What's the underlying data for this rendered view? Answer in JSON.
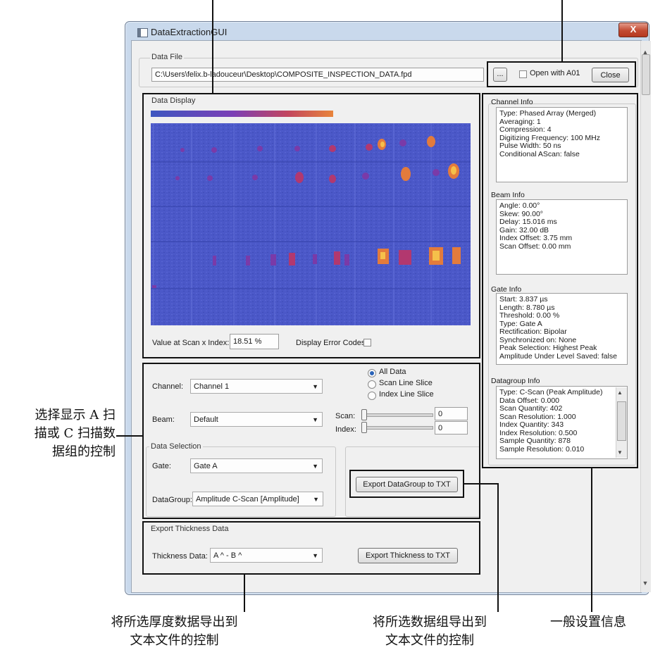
{
  "window": {
    "title": "DataExtractionGUI",
    "close_glyph": "X"
  },
  "data_file": {
    "group_label": "Data File",
    "path": "C:\\Users\\felix.b-ladouceur\\Desktop\\COMPOSITE_INSPECTION_DATA.fpd",
    "browse_label": "...",
    "open_with_label": "Open with A01",
    "close_label": "Close"
  },
  "data_display": {
    "group_label": "Data Display",
    "value_label": "Value at Scan x Index:",
    "value": "18.51 %",
    "error_codes_label": "Display Error Codes"
  },
  "controls": {
    "channel_label": "Channel:",
    "channel_value": "Channel 1",
    "beam_label": "Beam:",
    "beam_value": "Default",
    "radio_all": "All Data",
    "radio_scan": "Scan Line Slice",
    "radio_index": "Index Line Slice",
    "scan_label": "Scan:",
    "scan_value": "0",
    "index_label": "Index:",
    "index_value": "0",
    "data_selection_label": "Data Selection",
    "gate_label": "Gate:",
    "gate_value": "Gate A",
    "datagroup_label": "DataGroup:",
    "datagroup_value": "Amplitude C-Scan [Amplitude]",
    "export_datagroup_label": "Export DataGroup to TXT"
  },
  "thickness": {
    "group_label": "Export Thickness Data",
    "label": "Thickness Data:",
    "value": "A ^ - B ^",
    "export_label": "Export Thickness to TXT"
  },
  "info": {
    "channel": {
      "label": "Channel Info",
      "lines": [
        "Type: Phased Array (Merged)",
        "Averaging: 1",
        "Compression: 4",
        "Digitizing Frequency: 100 MHz",
        "Pulse Width: 50 ns",
        "Conditional AScan: false"
      ]
    },
    "beam": {
      "label": "Beam Info",
      "lines": [
        "Angle: 0.00°",
        "Skew: 90.00°",
        "Delay: 15.016 ms",
        "Gain: 32.00 dB",
        "Index Offset: 3.75 mm",
        "Scan Offset: 0.00 mm"
      ]
    },
    "gate": {
      "label": "Gate Info",
      "lines": [
        "Start: 3.837 µs",
        "Length: 8.780 µs",
        "Threshold: 0.00 %",
        "Type: Gate A",
        "Rectification: Bipolar",
        "Synchronized on: None",
        "Peak Selection: Highest Peak",
        "Amplitude Under Level Saved: false"
      ]
    },
    "datagroup": {
      "label": "Datagroup Info",
      "lines": [
        "Type: C-Scan (Peak Amplitude)",
        "Data Offset: 0.000",
        "Scan Quantity: 402",
        "Scan Resolution: 1.000",
        "Index Quantity: 343",
        "Index Resolution: 0.500",
        "Sample Quantity: 878",
        "Sample Resolution: 0.010"
      ]
    }
  },
  "annotations": {
    "left_control": [
      "选择显示 A 扫",
      "描或 C 扫描数",
      "据组的控制"
    ],
    "export_thickness": [
      "将所选厚度数据导出到",
      "文本文件的控制"
    ],
    "export_datagroup": [
      "将所选数据组导出到",
      "文本文件的控制"
    ],
    "general_info": "一般设置信息"
  },
  "colors": {
    "cscan_background": "#4b58c8",
    "indication_hot": "#f0a23a",
    "callout": "#111111"
  }
}
